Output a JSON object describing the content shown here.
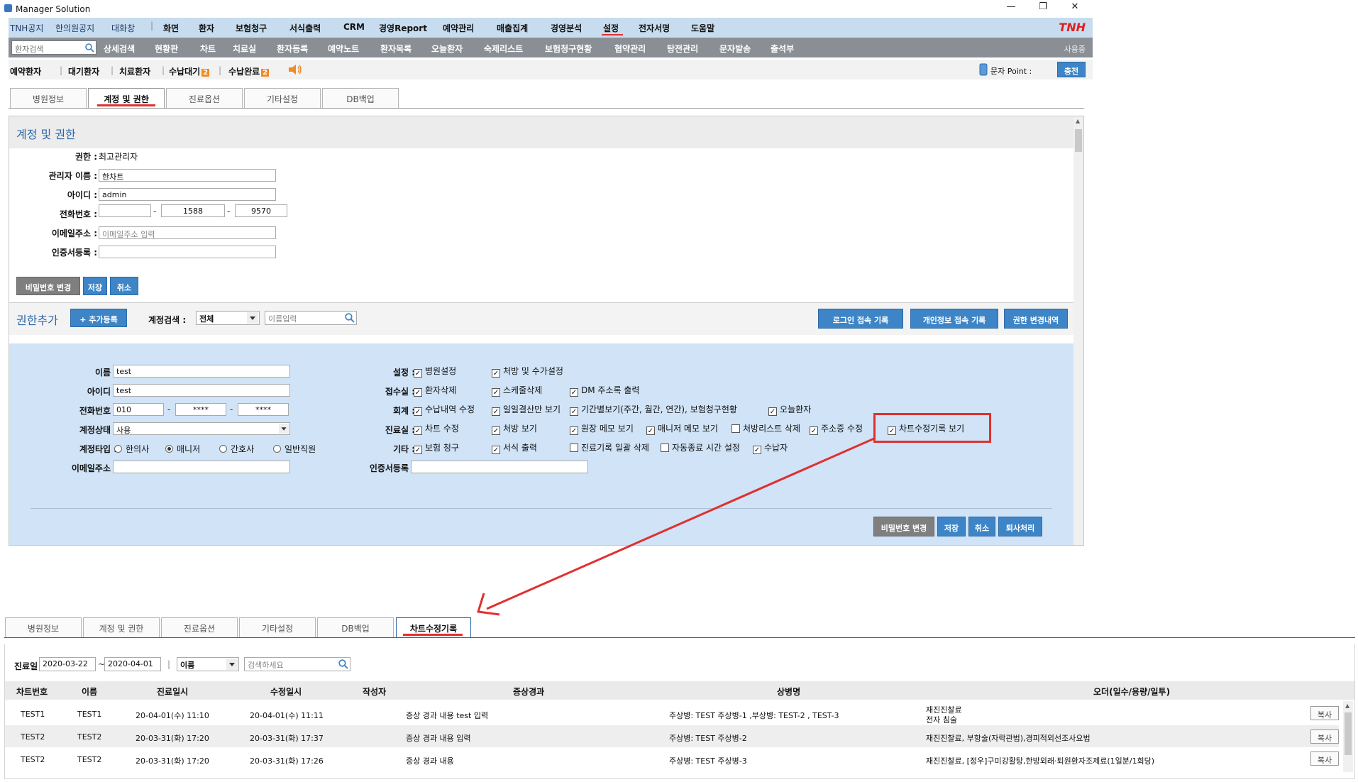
{
  "window": {
    "title": "Manager Solution",
    "min": "—",
    "max": "❐",
    "close": "✕"
  },
  "menu": {
    "left_items": [
      "TNH공지",
      "한의원공지",
      "대화창"
    ],
    "items": [
      "화면",
      "환자",
      "보험청구",
      "서식출력",
      "CRM",
      "경영Report",
      "예약관리",
      "매출집계",
      "경영분석",
      "설정",
      "전자서명",
      "도움말"
    ],
    "logo": "TNH"
  },
  "toolbar": {
    "search_placeholder": "환자검색",
    "items": [
      "상세검색",
      "현황판",
      "차트",
      "치료실",
      "환자등록",
      "예약노트",
      "환자목록",
      "오늘환자",
      "숙제리스트",
      "보험청구현황",
      "협약관리",
      "탕전관리",
      "문자발송",
      "출석부"
    ],
    "user": "사용중"
  },
  "subbar": {
    "items": [
      "예약환자",
      "대기환자",
      "치료환자",
      "수납대기",
      "수납완료"
    ],
    "badge_wait": "2",
    "badge_done": "2",
    "sms_point_label": "문자 Point :",
    "charge_button": "충전"
  },
  "tabs_top": [
    "병원정보",
    "계정 및 권한",
    "진료옵션",
    "기타설정",
    "DB백업"
  ],
  "account": {
    "section_title": "계정 및 권한",
    "role_label": "권한 :",
    "role_value": "최고관리자",
    "name_label": "관리자 이름 :",
    "name_value": "한차트",
    "id_label": "아이디 :",
    "id_value": "admin",
    "phone_label": "전화번호 :",
    "phone_1": "",
    "phone_2": "1588",
    "phone_3": "9570",
    "email_label": "이메일주소 :",
    "email_placeholder": "이메일주소 입력",
    "cert_label": "인증서등록 :",
    "btn_pw": "비밀번호 변경",
    "btn_save": "저장",
    "btn_cancel": "취소"
  },
  "perm": {
    "section_title": "권한추가",
    "add_button": "+ 추가등록",
    "search_label": "계정검색 :",
    "search_select": "전체",
    "search_placeholder": "이름입력",
    "btn_login_log": "로그인 접속 기록",
    "btn_privacy_log": "개인정보 접속 기록",
    "btn_perm_log": "권한 변경내역"
  },
  "user_form": {
    "name_label": "이름 :",
    "name_value": "test",
    "id_label": "아이디 :",
    "id_value": "test",
    "phone_label": "전화번호 :",
    "phone_1": "010",
    "phone_2": "****",
    "phone_3": "****",
    "status_label": "계정상태 :",
    "status_value": "사용",
    "type_label": "계정타입 :",
    "types": [
      "한의사",
      "매니저",
      "간호사",
      "일반직원"
    ],
    "email_label": "이메일주소 :",
    "cert_label": "인증서등록 :",
    "btn_pw": "비밀번호 변경",
    "btn_save": "저장",
    "btn_cancel": "취소",
    "btn_retire": "퇴사처리"
  },
  "perm_groups": {
    "settings_label": "설정 :",
    "settings": [
      "병원설정",
      "처방 및 수가설정"
    ],
    "reception_label": "접수실 :",
    "reception": [
      "환자삭제",
      "스케줄삭제",
      "DM 주소록 출력"
    ],
    "account_label": "회계 :",
    "accounting": [
      "수납내역 수정",
      "일일결산만 보기",
      "기간별보기(주간, 월간, 연간), 보험청구현황",
      "오늘환자"
    ],
    "clinic_label": "진료실 :",
    "clinic": [
      "차트 수정",
      "처방 보기",
      "원장 메모 보기",
      "매니저 메모 보기",
      "처방리스트 삭제",
      "주소증 수정",
      "차트수정기록 보기"
    ],
    "etc_label": "기타 :",
    "etc": [
      "보험 청구",
      "서식 출력",
      "진료기록 일괄 삭제",
      "자동종료 시간 설정",
      "수납자"
    ]
  },
  "tabs_bottom": [
    "병원정보",
    "계정 및 권한",
    "진료옵션",
    "기타설정",
    "DB백업",
    "차트수정기록"
  ],
  "filter": {
    "label": "진료일",
    "date_from": "2020-03-22",
    "date_to": "2020-04-01",
    "select": "이름",
    "search_placeholder": "검색하세요"
  },
  "table": {
    "headers": [
      "차트번호",
      "이름",
      "진료일시",
      "수정일시",
      "작성자",
      "증상경과",
      "상병명",
      "오더(일수/용량/일투)"
    ],
    "rows": [
      {
        "chart": "TEST1",
        "name": "TEST1",
        "visit": "20-04-01(수) 11:10",
        "modified": "20-04-01(수) 11:11",
        "writer": "",
        "symptom": "증상 경과 내용 test 입력",
        "diagnosis": "주상병:  TEST 주상병-1 ,부상병:  TEST-2 ,  TEST-3",
        "order": "재진진찰료",
        "order2": "전자 침술",
        "copy": "복사"
      },
      {
        "chart": "TEST2",
        "name": "TEST2",
        "visit": "20-03-31(화) 17:20",
        "modified": "20-03-31(화) 17:37",
        "writer": "",
        "symptom": "증상 경과 내용 입력",
        "diagnosis": "주상병:  TEST 주상병-2",
        "order": "재진진찰료, 부항술(자락관법),경피적외선조사요법",
        "order2": "",
        "copy": "복사"
      },
      {
        "chart": "TEST2",
        "name": "TEST2",
        "visit": "20-03-31(화) 17:20",
        "modified": "20-03-31(화) 17:26",
        "writer": "",
        "symptom": "증상 경과 내용",
        "diagnosis": "주상병:  TEST 주상병-3",
        "order": "재진진찰료, [정우]구미강활탕,한방외래·퇴원환자조제료(1일분/1회당)",
        "order2": "",
        "copy": "복사"
      }
    ]
  },
  "colors": {
    "accent": "#3d85c6",
    "highlight": "#e03030",
    "panel_bg": "#d0e3f7",
    "menu_bg": "#c7dcee"
  }
}
